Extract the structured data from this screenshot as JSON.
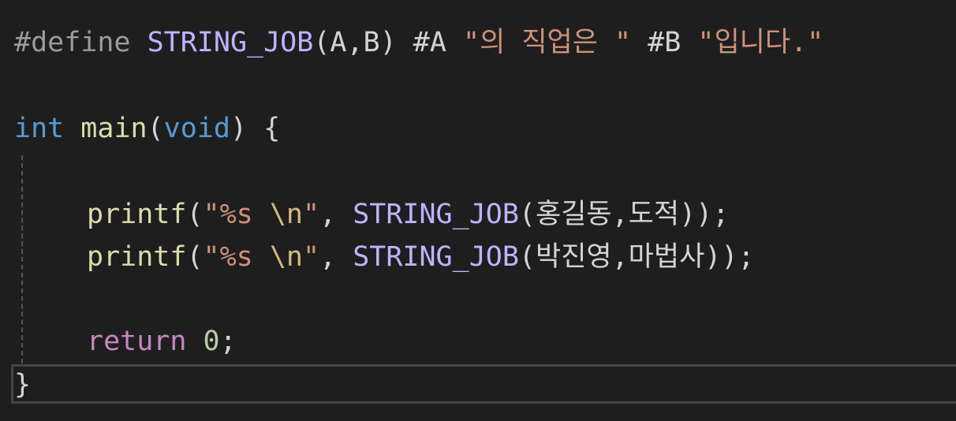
{
  "editor": {
    "line1": {
      "directive": "#define",
      "macro_name": "STRING_JOB",
      "open_paren": "(",
      "params": "A,B",
      "close_paren": ")",
      "stringize_a": "#A",
      "string1": "\"의 직업은 \"",
      "stringize_b": "#B",
      "string2": "\"입니다.\""
    },
    "line3": {
      "type_kw": "int",
      "func_name": "main",
      "open_paren": "(",
      "param_kw": "void",
      "close_paren": ")",
      "brace": "{"
    },
    "line5": {
      "func": "printf",
      "open_paren": "(",
      "str_open": "\"%s ",
      "escape": "\\n",
      "str_close": "\"",
      "comma": ", ",
      "macro": "STRING_JOB",
      "macro_open": "(",
      "args": "홍길동,도적",
      "macro_close": ")",
      "close": ");"
    },
    "line6": {
      "func": "printf",
      "open_paren": "(",
      "str_open": "\"%s ",
      "escape": "\\n",
      "str_close": "\"",
      "comma": ", ",
      "macro": "STRING_JOB",
      "macro_open": "(",
      "args": "박진영,마법사",
      "macro_close": ")",
      "close": ");"
    },
    "line8": {
      "keyword": "return",
      "value": "0",
      "semicolon": ";"
    },
    "line9": {
      "brace": "}"
    }
  },
  "colors": {
    "background": "#1e1e1e",
    "keyword": "#569cd6",
    "function": "#dcdcaa",
    "string": "#ce9178",
    "macro": "#bdb3ff",
    "control": "#c586c0",
    "number": "#b5cea8",
    "escape": "#d7ba7d"
  }
}
